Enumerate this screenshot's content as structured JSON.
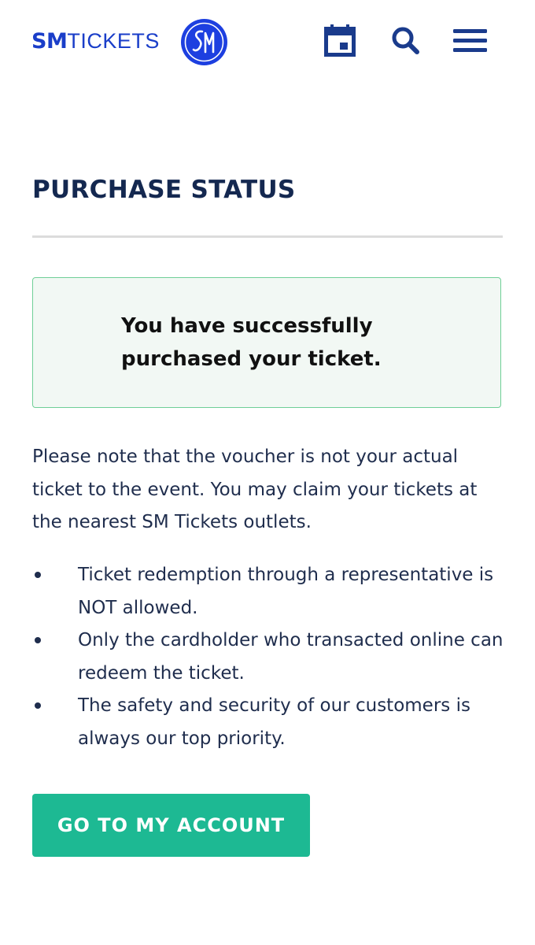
{
  "header": {
    "logo_sm": "SM",
    "logo_tickets": "TICKETS",
    "brand_color": "#1a3ec9",
    "icons": [
      "calendar-icon",
      "search-icon",
      "menu-icon"
    ]
  },
  "main": {
    "title": "PURCHASE STATUS",
    "success_message": "You have successfully purchased your ticket.",
    "note": "Please note that the voucher is not your actual ticket to the event. You may claim your tickets at the nearest SM Tickets outlets.",
    "bullets": [
      "Ticket redemption through a representative is NOT allowed.",
      "Only the cardholder who transacted online can redeem the ticket.",
      "The safety and security of our customers is always our top priority."
    ],
    "button_label": "GO TO MY ACCOUNT",
    "button_color": "#1db993",
    "success_border_color": "#6fcf97",
    "title_color": "#142850"
  }
}
